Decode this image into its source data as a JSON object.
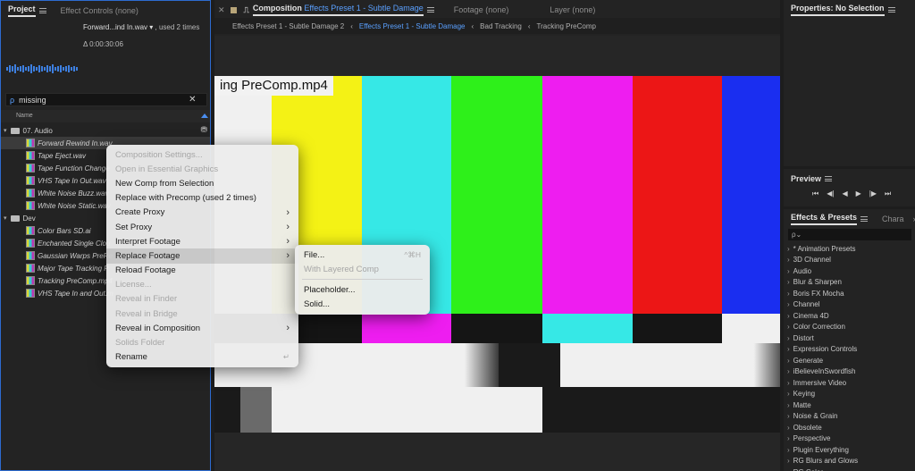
{
  "project_panel": {
    "tab_project": "Project",
    "tab_effect_controls": "Effect Controls (none)",
    "clip_name": "Forward...ind In.wav",
    "clip_usage": ", used 2 times",
    "clip_duration": "Δ 0:00:30:06",
    "search_value": "missing",
    "column_name": "Name",
    "rows": [
      {
        "type": "folder",
        "label": "07. Audio"
      },
      {
        "type": "item",
        "label": "Forward Rewind In.wav",
        "selected": true
      },
      {
        "type": "item",
        "label": "Tape Eject.wav"
      },
      {
        "type": "item",
        "label": "Tape Function Change"
      },
      {
        "type": "item",
        "label": "VHS Tape In Out.wav"
      },
      {
        "type": "item",
        "label": "White Noise Buzz.wav"
      },
      {
        "type": "item",
        "label": "White Noise Static.wav"
      },
      {
        "type": "folder",
        "label": "Dev"
      },
      {
        "type": "item",
        "label": "Color Bars SD.ai"
      },
      {
        "type": "item",
        "label": "Enchanted Single Clou"
      },
      {
        "type": "item",
        "label": "Gaussian Warps PreRe"
      },
      {
        "type": "item",
        "label": "Major Tape Tracking P"
      },
      {
        "type": "item",
        "label": "Tracking PreComp.mp4"
      },
      {
        "type": "item",
        "label": "VHS Tape In and Out.m"
      }
    ]
  },
  "composition": {
    "tab_label": "Composition",
    "tab_name": "Effects Preset 1 - Subtle Damage",
    "footage_tab": "Footage (none)",
    "layer_tab": "Layer (none)",
    "subtabs": [
      "Effects Preset 1 - Subtle Damage 2",
      "Effects Preset 1 - Subtle Damage",
      "Bad Tracking",
      "Tracking PreComp"
    ],
    "viewer_title": "ing PreComp.mp4"
  },
  "properties": {
    "title": "Properties: No Selection"
  },
  "preview": {
    "title": "Preview",
    "controls": [
      "⏮",
      "◀|",
      "◀",
      "▶",
      "|▶",
      "⏭"
    ]
  },
  "effects": {
    "tab_title": "Effects & Presets",
    "tab_other": "Chara",
    "search_placeholder": "ρ⌄",
    "items": [
      "* Animation Presets",
      "3D Channel",
      "Audio",
      "Blur & Sharpen",
      "Boris FX Mocha",
      "Channel",
      "Cinema 4D",
      "Color Correction",
      "Distort",
      "Expression Controls",
      "Generate",
      "iBelieveInSwordfish",
      "Immersive Video",
      "Keying",
      "Matte",
      "Noise & Grain",
      "Obsolete",
      "Perspective",
      "Plugin Everything",
      "RG Blurs and Glows",
      "RG Color"
    ]
  },
  "context_menu": {
    "items": [
      {
        "label": "Composition Settings...",
        "disabled": true
      },
      {
        "label": "Open in Essential Graphics",
        "disabled": true
      },
      {
        "label": "New Comp from Selection"
      },
      {
        "label": "Replace with Precomp (used 2 times)"
      },
      {
        "label": "Create Proxy",
        "submenu": true
      },
      {
        "label": "Set Proxy",
        "submenu": true
      },
      {
        "label": "Interpret Footage",
        "submenu": true
      },
      {
        "label": "Replace Footage",
        "submenu": true,
        "highlighted": true
      },
      {
        "label": "Reload Footage"
      },
      {
        "label": "License...",
        "disabled": true
      },
      {
        "label": "Reveal in Finder",
        "disabled": true
      },
      {
        "label": "Reveal in Bridge",
        "disabled": true
      },
      {
        "label": "Reveal in Composition",
        "submenu": true
      },
      {
        "label": "Solids Folder",
        "disabled": true
      },
      {
        "label": "Rename",
        "shortcut": "↵"
      }
    ]
  },
  "submenu": {
    "items": [
      {
        "label": "File...",
        "shortcut": "^⌘H"
      },
      {
        "label": "With Layered Comp",
        "disabled": true
      },
      {
        "separator": true
      },
      {
        "label": "Placeholder..."
      },
      {
        "label": "Solid..."
      }
    ]
  },
  "colors": {
    "accent_blue": "#2d6bd0",
    "bar_white": "#f0f0f0",
    "bar_yellow": "#f4f215",
    "bar_cyan": "#36e8e6",
    "bar_green": "#2ef01a",
    "bar_magenta": "#ee1df0",
    "bar_red": "#ec1616",
    "bar_blue": "#1a2ef0"
  }
}
